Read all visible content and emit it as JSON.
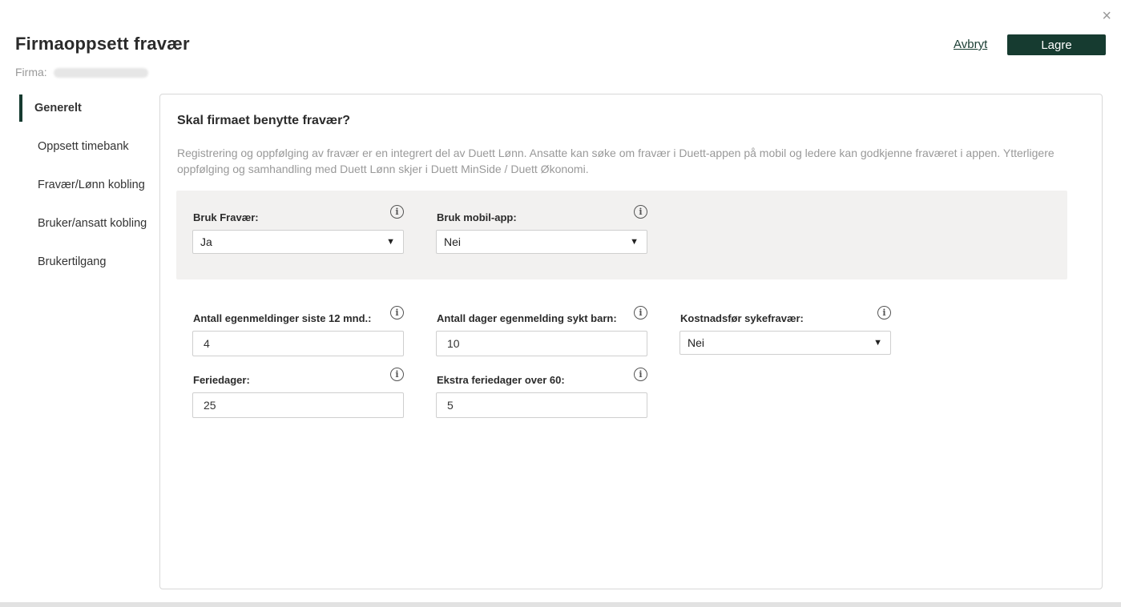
{
  "header": {
    "title": "Firmaoppsett fravær",
    "firma_label": "Firma:",
    "cancel_label": "Avbryt",
    "save_label": "Lagre",
    "close_glyph": "×"
  },
  "sidebar": {
    "items": [
      {
        "label": "Generelt",
        "active": true
      },
      {
        "label": "Oppsett timebank"
      },
      {
        "label": "Fravær/Lønn kobling"
      },
      {
        "label": "Bruker/ansatt kobling"
      },
      {
        "label": "Brukertilgang"
      }
    ]
  },
  "panel": {
    "heading": "Skal firmaet benytte fravær?",
    "description": "Registrering og oppfølging av fravær er en integrert del av Duett Lønn. Ansatte kan søke om fravær i Duett-appen på mobil og ledere kan godkjenne fraværet i appen. Ytterligere oppfølging og samhandling med Duett Lønn skjer i Duett MinSide / Duett Økonomi.",
    "fields": {
      "bruk_fravaer": {
        "label": "Bruk Fravær:",
        "value": "Ja"
      },
      "bruk_mobil_app": {
        "label": "Bruk mobil-app:",
        "value": "Nei"
      },
      "antall_egenmeldinger": {
        "label": "Antall egenmeldinger siste 12 mnd.:",
        "value": "4"
      },
      "antall_dager_sykt_barn": {
        "label": "Antall dager egenmelding sykt barn:",
        "value": "10"
      },
      "kostnadsfor_sykefravaer": {
        "label": "Kostnadsfør sykefravær:",
        "value": "Nei"
      },
      "feriedager": {
        "label": "Feriedager:",
        "value": "25"
      },
      "ekstra_feriedager": {
        "label": "Ekstra feriedager over 60:",
        "value": "5"
      }
    }
  },
  "icons": {
    "info": "i",
    "caret": "▼"
  },
  "colors": {
    "accent": "#163b30",
    "panel_gray": "#f2f1f0",
    "muted_text": "#999999"
  }
}
